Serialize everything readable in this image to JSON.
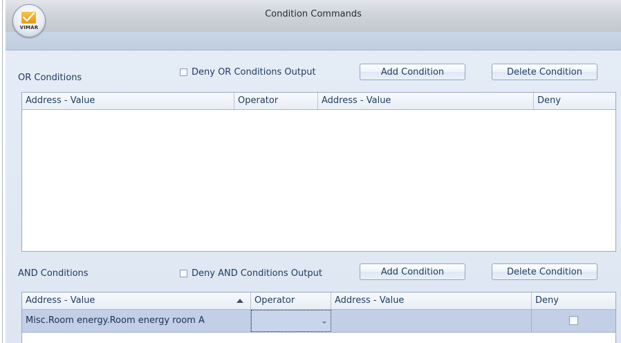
{
  "window": {
    "title": "Condition Commands"
  },
  "app_logo": {
    "text": "VIMAR"
  },
  "or_section": {
    "label": "OR Conditions",
    "deny_checkbox": {
      "label": "Deny OR Conditions Output",
      "checked": false
    },
    "add_button": "Add Condition",
    "delete_button": "Delete Condition",
    "columns": [
      "Address - Value",
      "Operator",
      "Address - Value",
      "Deny"
    ],
    "rows": []
  },
  "and_section": {
    "label": "AND Conditions",
    "deny_checkbox": {
      "label": "Deny AND Conditions Output",
      "checked": false
    },
    "add_button": "Add Condition",
    "delete_button": "Delete Condition",
    "columns": [
      "Address - Value",
      "Operator",
      "Address - Value",
      "Deny"
    ],
    "sorted_column": "Address - Value",
    "rows": [
      {
        "address_value_1": "Misc.Room energy.Room energy room A",
        "operator": "",
        "address_value_2": "",
        "deny": false
      }
    ]
  },
  "colors": {
    "selected_row": "#c2cfe6",
    "text": "#1e3a5f",
    "background": "#dde6f2"
  }
}
